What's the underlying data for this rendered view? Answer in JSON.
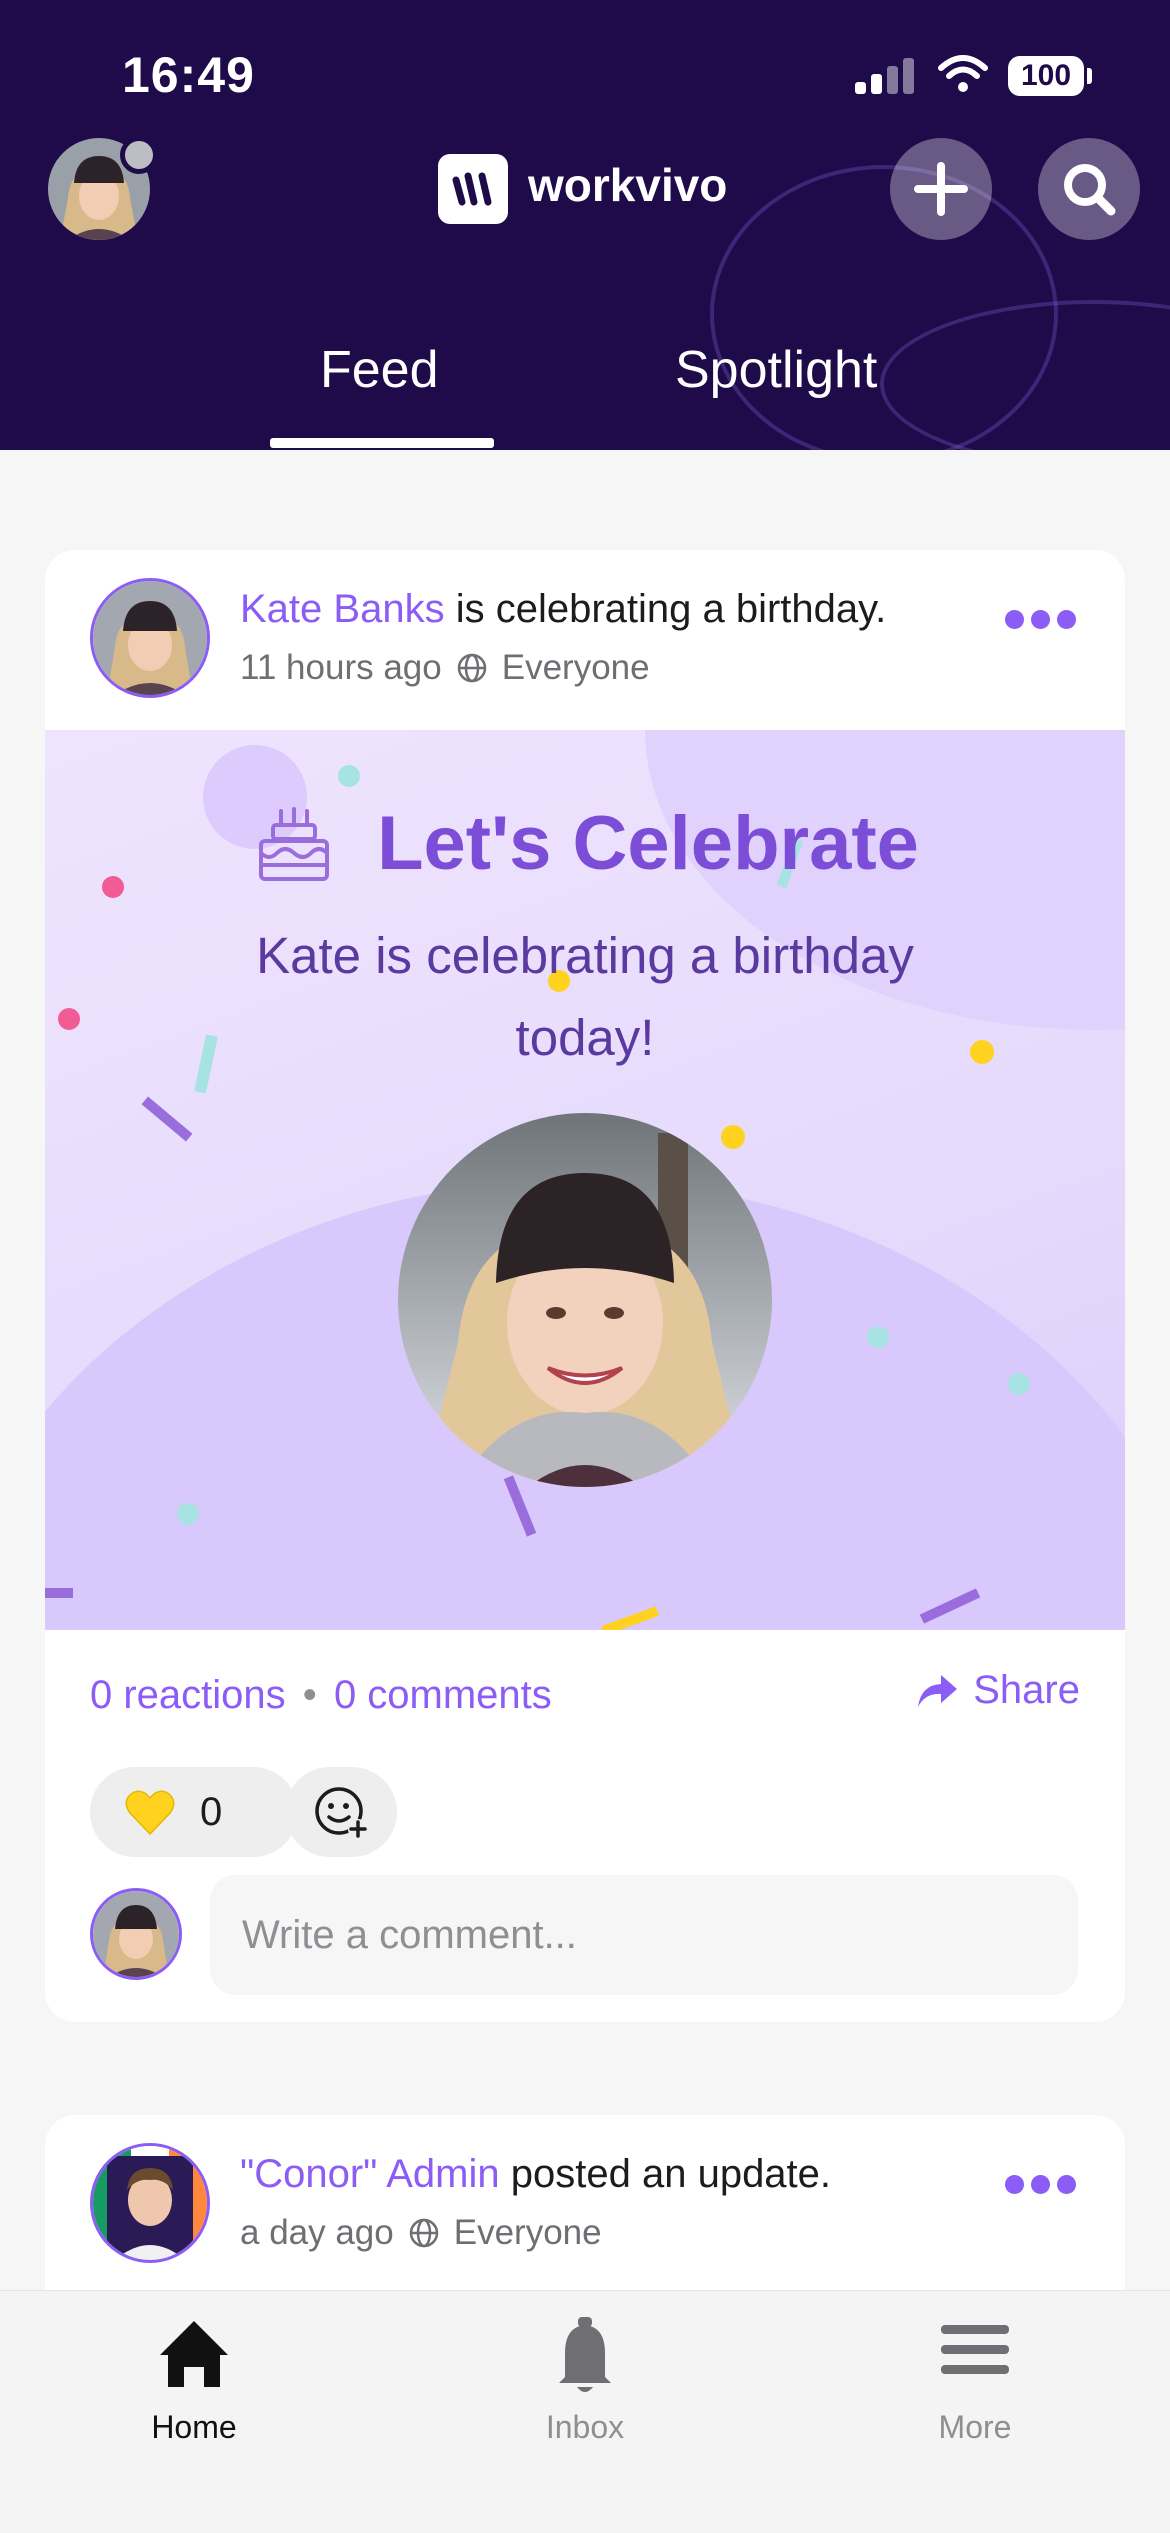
{
  "status_bar": {
    "time": "16:49",
    "battery": "100"
  },
  "header": {
    "app_name": "workvivo",
    "tabs": [
      {
        "label": "Feed",
        "active": true
      },
      {
        "label": "Spotlight",
        "active": false
      }
    ]
  },
  "posts": [
    {
      "author": "Kate Banks",
      "action": " is celebrating a birthday.",
      "time": "11 hours ago",
      "audience": "Everyone",
      "banner": {
        "title": "Let's Celebrate",
        "subtitle": "Kate is celebrating a birthday today!"
      },
      "stats": {
        "reactions": "0 reactions",
        "separator": "•",
        "comments": "0 comments"
      },
      "share_label": "Share",
      "reaction_count": "0",
      "comment_placeholder": "Write a comment..."
    },
    {
      "author": "\"Conor\" Admin",
      "action": " posted an update.",
      "time": "a day ago",
      "audience": "Everyone"
    }
  ],
  "bottom_nav": [
    {
      "label": "Home",
      "active": true
    },
    {
      "label": "Inbox",
      "active": false
    },
    {
      "label": "More",
      "active": false
    }
  ],
  "colors": {
    "header_bg": "#1f0a4a",
    "accent": "#8b5cf6",
    "banner_bg": "#e6dafc"
  }
}
